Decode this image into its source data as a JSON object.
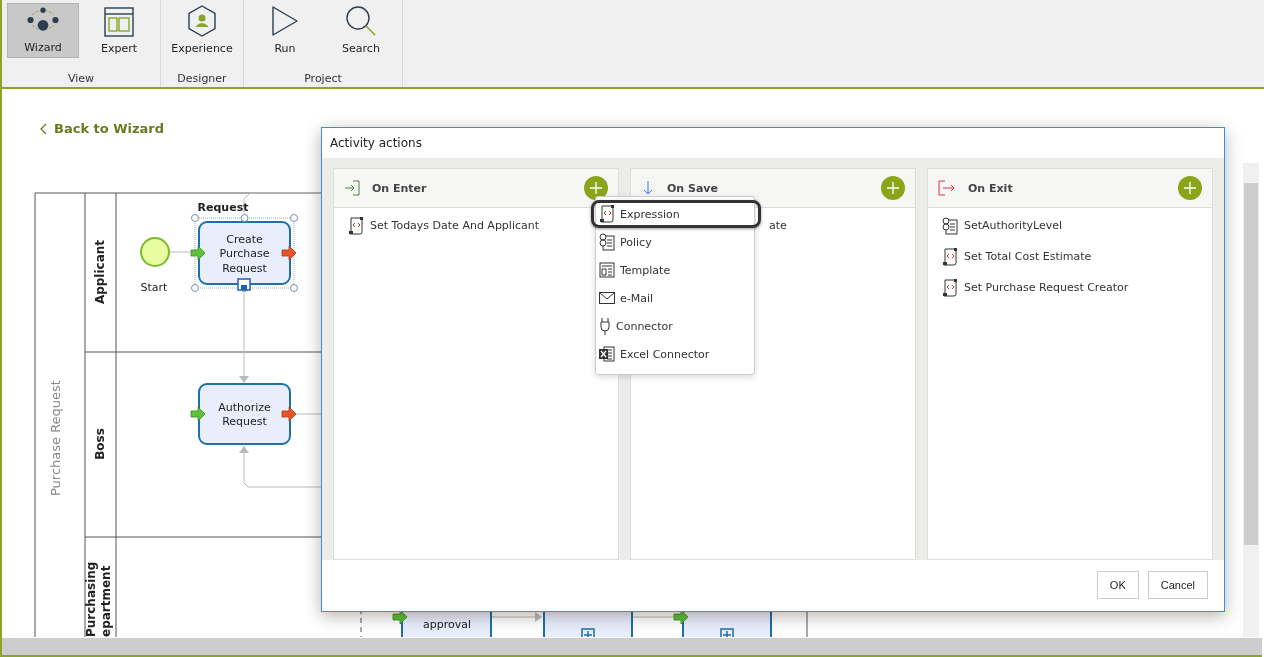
{
  "ribbon": {
    "groups": [
      {
        "label": "View",
        "buttons": [
          {
            "label": "Wizard",
            "selected": true
          },
          {
            "label": "Expert",
            "selected": false
          }
        ]
      },
      {
        "label": "Designer",
        "buttons": [
          {
            "label": "Experience",
            "selected": false
          }
        ]
      },
      {
        "label": "Project",
        "buttons": [
          {
            "label": "Run",
            "selected": false
          },
          {
            "label": "Search",
            "selected": false
          }
        ]
      }
    ]
  },
  "back_link": "Back to Wizard",
  "diagram": {
    "pool": "Purchase Request",
    "lanes": [
      {
        "label": [
          "Applicant"
        ]
      },
      {
        "label": [
          "Boss"
        ]
      },
      {
        "label": [
          "Purchasing",
          "epartment"
        ]
      }
    ],
    "start": "Start",
    "flow_label": "Request",
    "tasks": [
      {
        "label": [
          "Create",
          "Purchase",
          "Request"
        ],
        "selected": true
      },
      {
        "label": [
          "Authorize",
          "Request"
        ],
        "selected": false
      }
    ],
    "bottom_task": "approval"
  },
  "dialog": {
    "title": "Activity actions",
    "panels": [
      {
        "kind": "enter",
        "title": "On Enter",
        "items": [
          {
            "kind": "expression",
            "label": "Set Todays Date And Applicant"
          }
        ]
      },
      {
        "kind": "save",
        "title": "On Save",
        "items": [
          {
            "kind": "hidden",
            "label": "ate"
          }
        ]
      },
      {
        "kind": "exit",
        "title": "On Exit",
        "items": [
          {
            "kind": "policy",
            "label": "SetAuthorityLevel"
          },
          {
            "kind": "expression",
            "label": "Set Total Cost Estimate"
          },
          {
            "kind": "expression",
            "label": "Set Purchase Request Creator"
          }
        ]
      }
    ],
    "add_menu": [
      {
        "kind": "expression",
        "label": "Expression",
        "selected": true
      },
      {
        "kind": "policy",
        "label": "Policy",
        "selected": false
      },
      {
        "kind": "template",
        "label": "Template",
        "selected": false
      },
      {
        "kind": "email",
        "label": "e-Mail",
        "selected": false
      },
      {
        "kind": "connector",
        "label": "Connector",
        "selected": false
      },
      {
        "kind": "excel",
        "label": "Excel Connector",
        "selected": false
      }
    ],
    "buttons": [
      "OK",
      "Cancel"
    ]
  }
}
